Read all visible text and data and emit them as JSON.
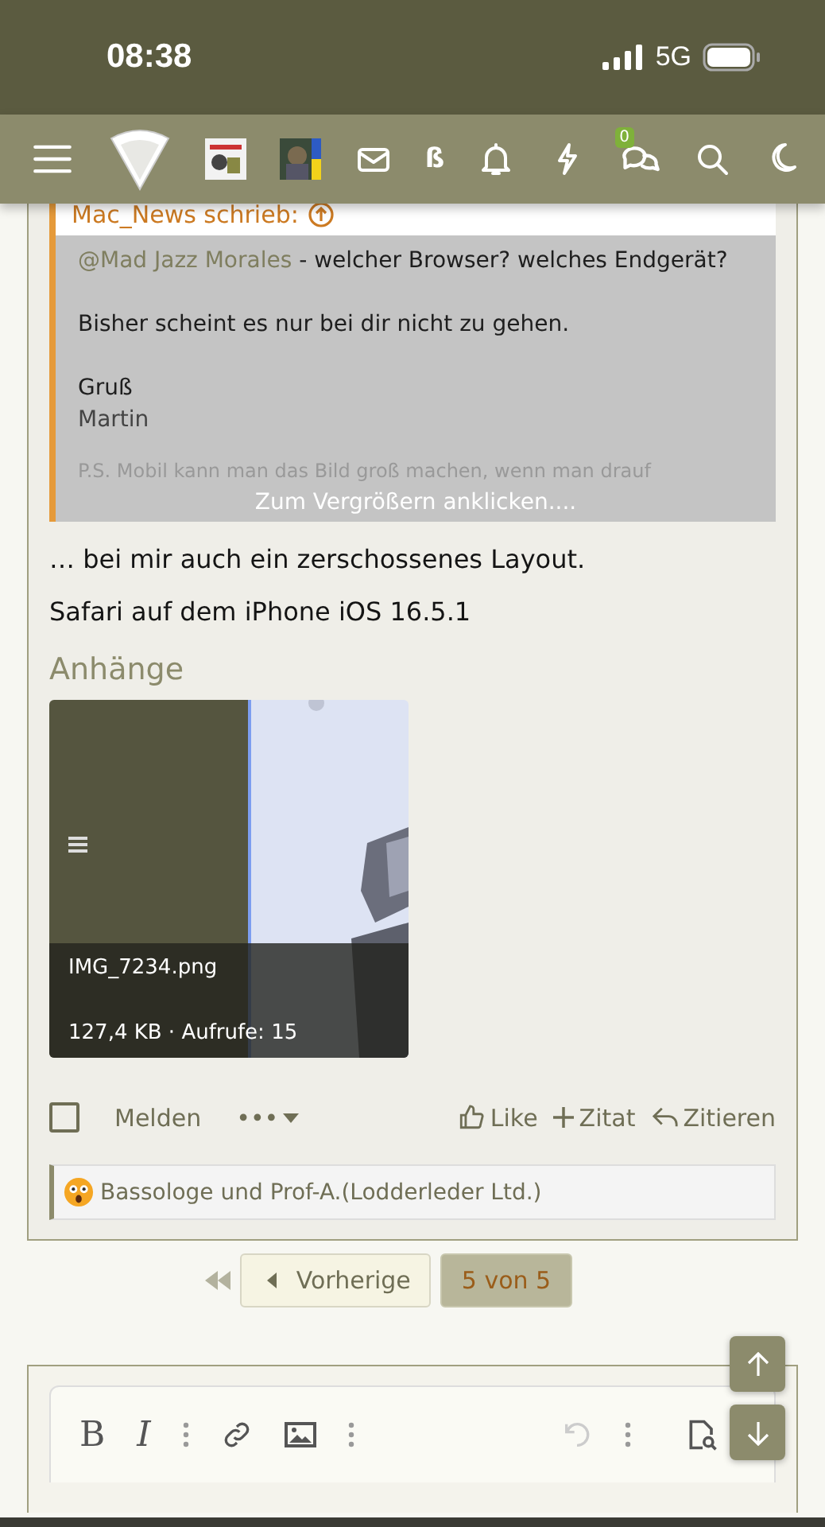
{
  "status_bar": {
    "time": "08:38",
    "network": "5G"
  },
  "nav": {
    "beta": "ß",
    "conversations_badge": "0"
  },
  "quote": {
    "author": "Mac_News schrieb:",
    "mention": "@Mad Jazz Morales",
    "first_line_rest": " - welcher Browser? welches Endgerät?",
    "lines": [
      {
        "kind": "text",
        "text": "Bisher scheint es nur bei dir nicht zu gehen."
      },
      {
        "kind": "text",
        "text": "Gruß"
      },
      {
        "kind": "signature",
        "text": "Martin"
      },
      {
        "kind": "faded",
        "text": "P.S. Mobil kann man das Bild groß machen, wenn man drauf"
      }
    ],
    "expand": "Zum Vergrößern anklicken...."
  },
  "post_lines": [
    "… bei mir auch ein zerschossenes Layout.",
    "Safari auf dem iPhone iOS 16.5.1"
  ],
  "attachments": {
    "title": "Anhänge",
    "items": [
      {
        "kind": "picture",
        "filename": "IMG_7234.png",
        "meta": "127,4 KB · Aufrufe: 15"
      }
    ]
  },
  "actions": {
    "select": {
      "checked": false
    },
    "report": "Melden",
    "more": "•••",
    "like": "Like",
    "quote": "Zitat",
    "reply": "Zitieren"
  },
  "reactions": "Bassologe und Prof-A.(Lodderleder Ltd.)",
  "pagination": {
    "previous": "Vorherige",
    "pages": [
      {
        "label": "5 von 5",
        "selected": true
      }
    ]
  },
  "editor": {
    "bold": "B",
    "italic": "I"
  }
}
